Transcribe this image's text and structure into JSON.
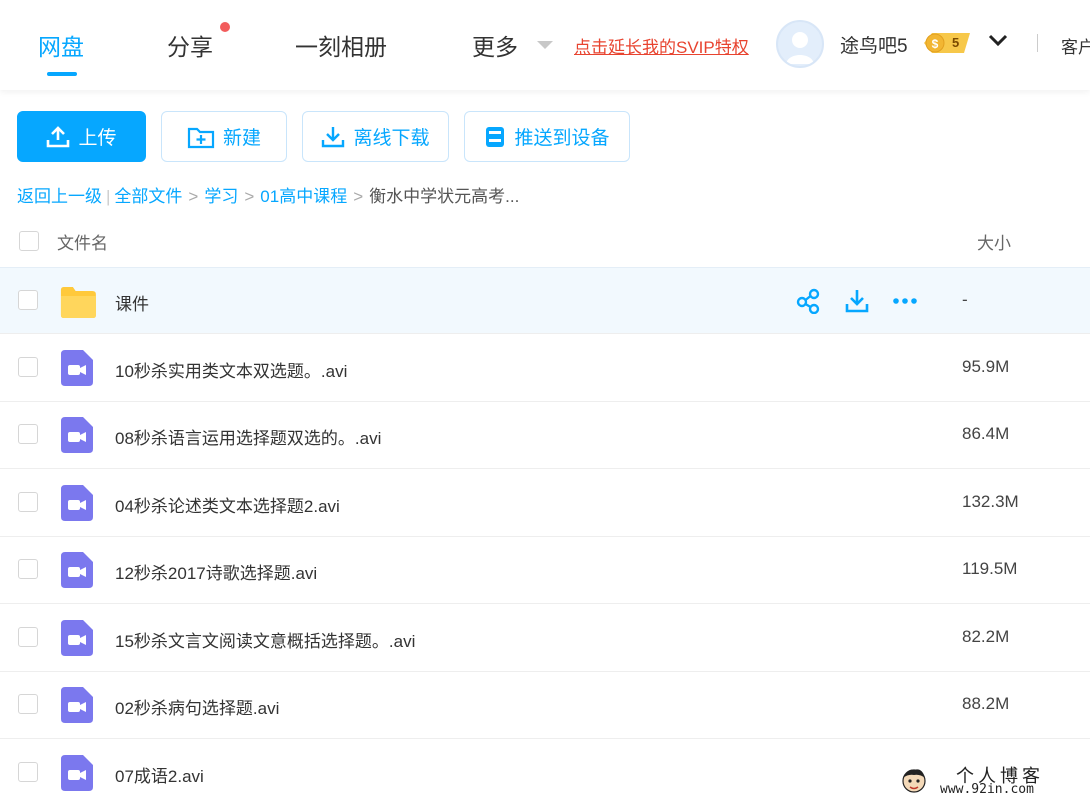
{
  "nav": {
    "tabs": [
      {
        "label": "网盘",
        "active": true
      },
      {
        "label": "分享",
        "has_dot": true
      },
      {
        "label": "一刻相册"
      },
      {
        "label": "更多"
      }
    ],
    "svip_promo": "点击延长我的SVIP特权",
    "username": "途鸟吧5",
    "vip_level": "5",
    "client_label": "客户"
  },
  "toolbar": {
    "upload_label": "上传",
    "new_label": "新建",
    "offline_label": "离线下载",
    "push_label": "推送到设备"
  },
  "breadcrumb": {
    "back": "返回上一级",
    "items": [
      "全部文件",
      "学习",
      "01高中课程"
    ],
    "current": "衡水中学状元高考..."
  },
  "table": {
    "col_name": "文件名",
    "col_size": "大小",
    "rows": [
      {
        "name": "课件",
        "size": "-",
        "type": "folder",
        "hover": true
      },
      {
        "name": "10秒杀实用类文本双选题。.avi",
        "size": "95.9M",
        "type": "video"
      },
      {
        "name": "08秒杀语言运用选择题双选的。.avi",
        "size": "86.4M",
        "type": "video"
      },
      {
        "name": "04秒杀论述类文本选择题2.avi",
        "size": "132.3M",
        "type": "video"
      },
      {
        "name": "12秒杀2017诗歌选择题.avi",
        "size": "119.5M",
        "type": "video"
      },
      {
        "name": "15秒杀文言文阅读文意概括选择题。.avi",
        "size": "82.2M",
        "type": "video"
      },
      {
        "name": "02秒杀病句选择题.avi",
        "size": "88.2M",
        "type": "video"
      },
      {
        "name": "07成语2.avi",
        "size": "",
        "type": "video"
      }
    ]
  },
  "watermark": {
    "title": "个人博客",
    "url": "www.92in.com"
  },
  "colors": {
    "accent": "#06a7ff",
    "promo": "#e8432f",
    "video_icon": "#7b78ee",
    "folder_icon": "#ffd257"
  }
}
